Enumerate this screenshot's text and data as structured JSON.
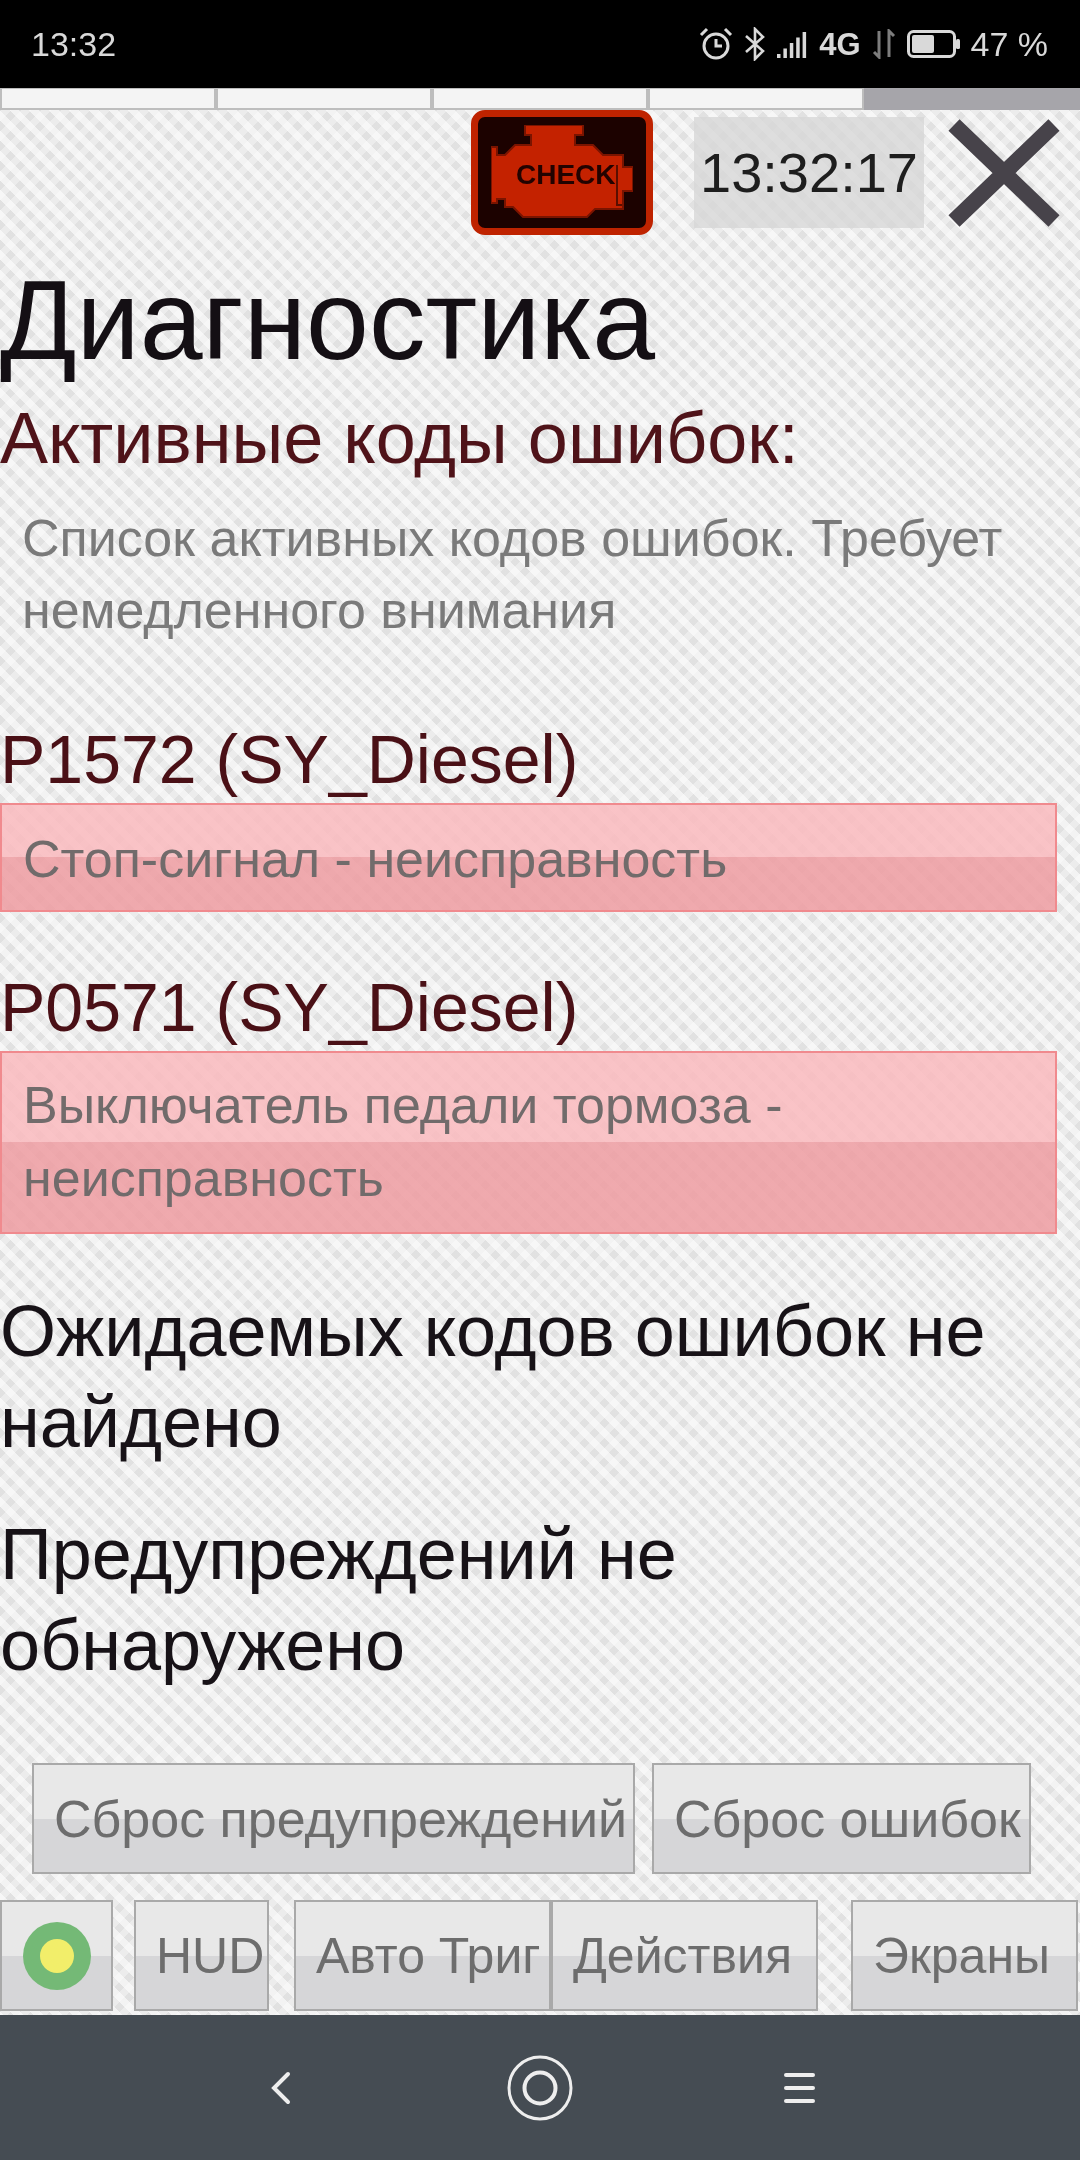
{
  "status_bar": {
    "time": "13:32",
    "network": "4G",
    "battery": "47 %"
  },
  "pager": [
    {
      "selected": false
    },
    {
      "selected": false
    },
    {
      "selected": false
    },
    {
      "selected": false
    },
    {
      "selected": true
    }
  ],
  "header": {
    "badge": "CHECK",
    "clock": "13:32:17"
  },
  "title": "Диагностика",
  "active_codes": {
    "heading": "Активные коды ошибок:",
    "description": "Список активных кодов ошибок. Требует немедленного внимания",
    "codes": [
      {
        "code": "P1572 (SY_Diesel)",
        "message": "Стоп-сигнал - неисправность"
      },
      {
        "code": "P0571 (SY_Diesel)",
        "message": "Выключатель педали тормоза - неисправность"
      }
    ]
  },
  "messages": [
    "Ожидаемых кодов ошибок не найдено",
    "Предупреждений не обнаружено"
  ],
  "reset_buttons": [
    "Сброс предупреждений",
    "Сброс ошибок"
  ],
  "bottom_bar": [
    {
      "kind": "indicator",
      "color": "#74b976"
    },
    {
      "kind": "button",
      "label": "HUD"
    },
    {
      "kind": "button",
      "label": "Авто Триг"
    },
    {
      "kind": "button",
      "label": "Действия"
    },
    {
      "kind": "button",
      "label": "Экраны"
    }
  ]
}
